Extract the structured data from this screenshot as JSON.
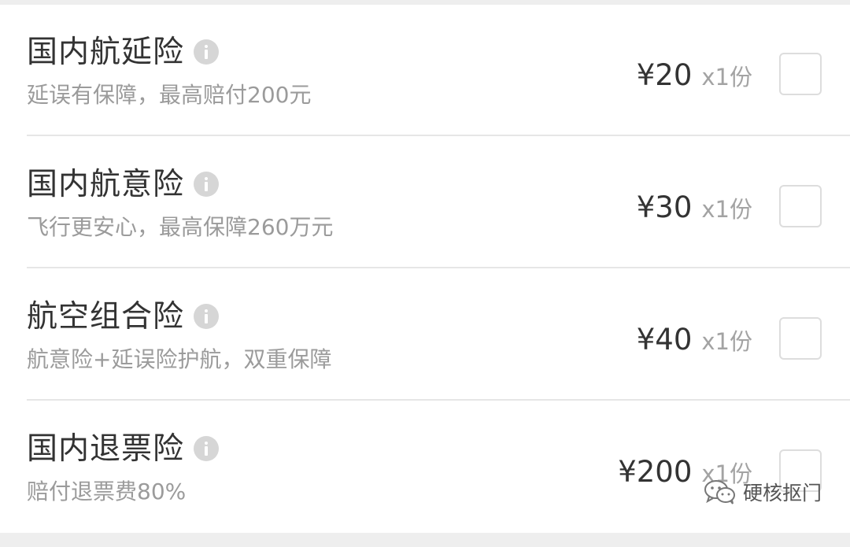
{
  "insurance_options": [
    {
      "title": "国内航延险",
      "subtitle": "延误有保障，最高赔付200元",
      "price": "¥20",
      "quantity": "x1份",
      "checked": false,
      "info_icon": "info-icon"
    },
    {
      "title": "国内航意险",
      "subtitle": "飞行更安心，最高保障260万元",
      "price": "¥30",
      "quantity": "x1份",
      "checked": false,
      "info_icon": "info-icon"
    },
    {
      "title": "航空组合险",
      "subtitle": "航意险+延误险护航，双重保障",
      "price": "¥40",
      "quantity": "x1份",
      "checked": false,
      "info_icon": "info-icon"
    },
    {
      "title": "国内退票险",
      "subtitle": "赔付退票费80%",
      "price": "¥200",
      "quantity": "x1份",
      "checked": false,
      "info_icon": "info-icon"
    }
  ],
  "watermark": {
    "text": "硬核抠门",
    "icon": "wechat-icon"
  },
  "colors": {
    "title": "#333333",
    "subtitle": "#9b9b9b",
    "quantity": "#a3a3a3",
    "checkbox_border": "#dddddd",
    "info_icon": "#d6d6d6",
    "background": "#f0f0f0"
  }
}
